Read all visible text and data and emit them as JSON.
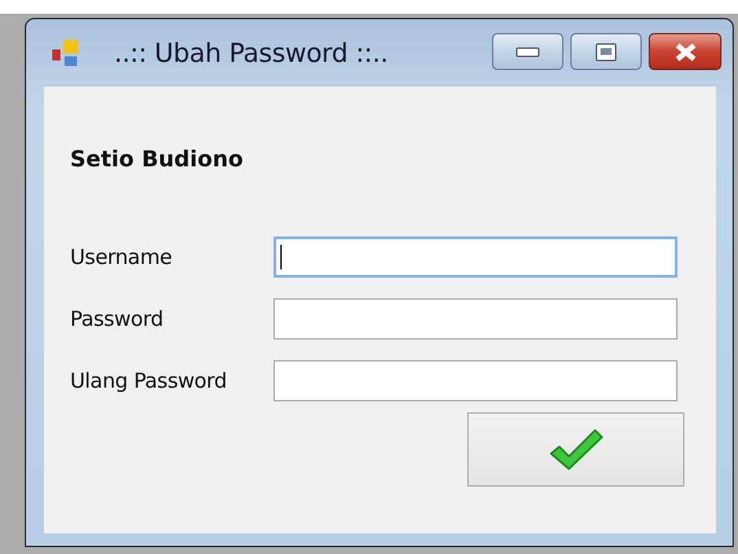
{
  "window": {
    "title": "..:: Ubah Password ::.."
  },
  "user_name": "Setio Budiono",
  "fields": [
    {
      "label": "Username",
      "focused": true
    },
    {
      "label": "Password",
      "focused": false
    },
    {
      "label": "Ulang Password",
      "focused": false
    }
  ]
}
